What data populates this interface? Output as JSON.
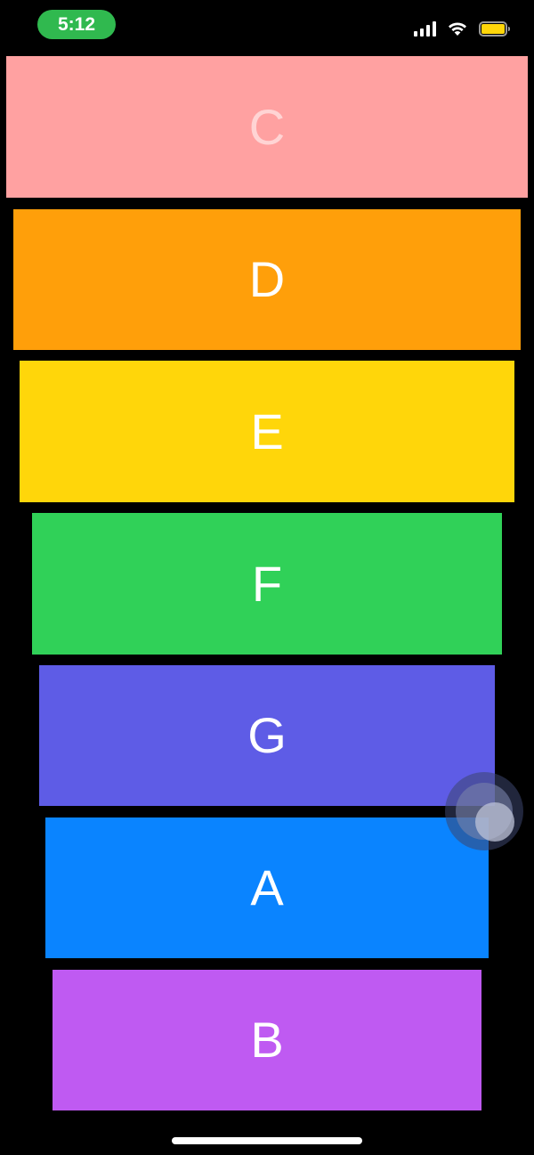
{
  "status_bar": {
    "time": "5:12",
    "icons": [
      "signal-icon",
      "wifi-icon",
      "battery-icon"
    ],
    "time_pill_color": "#30b94f",
    "battery_color": "#ffd60a"
  },
  "cards": [
    {
      "label": "C",
      "color": "#ffa1a1"
    },
    {
      "label": "D",
      "color": "#ff9f0a"
    },
    {
      "label": "E",
      "color": "#ffd60a"
    },
    {
      "label": "F",
      "color": "#30d158"
    },
    {
      "label": "G",
      "color": "#5e5ce6"
    },
    {
      "label": "A",
      "color": "#0a84ff"
    },
    {
      "label": "B",
      "color": "#bf5af2"
    }
  ],
  "background": "#000000"
}
